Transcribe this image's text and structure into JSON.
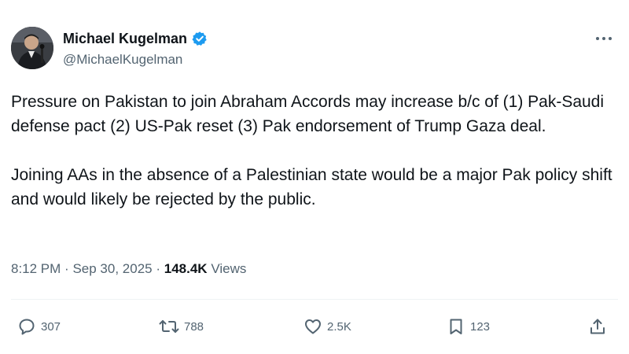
{
  "author": {
    "display_name": "Michael Kugelman",
    "handle": "@MichaelKugelman",
    "verified": true
  },
  "tweet": {
    "paragraphs": [
      "Pressure on Pakistan to join Abraham Accords may increase b/c of (1) Pak-Saudi defense pact (2) US-Pak reset (3) Pak endorsement of Trump Gaza deal.",
      "Joining AAs in the absence of a Palestinian state would be a major Pak policy shift and would likely be rejected by the public."
    ],
    "time": "8:12 PM",
    "date": "Sep 30, 2025",
    "separator": "·",
    "views_count": "148.4K",
    "views_label": "Views"
  },
  "actions": {
    "replies": "307",
    "reposts": "788",
    "likes": "2.5K",
    "bookmarks": "123"
  },
  "icons": {
    "verified": "verified-badge-icon",
    "more": "more-options-icon",
    "reply": "reply-icon",
    "repost": "repost-icon",
    "like": "heart-icon",
    "bookmark": "bookmark-icon",
    "share": "share-icon"
  },
  "colors": {
    "text_primary": "#0f1419",
    "text_secondary": "#536471",
    "verified_blue": "#1d9bf0",
    "divider": "#eff3f4"
  }
}
